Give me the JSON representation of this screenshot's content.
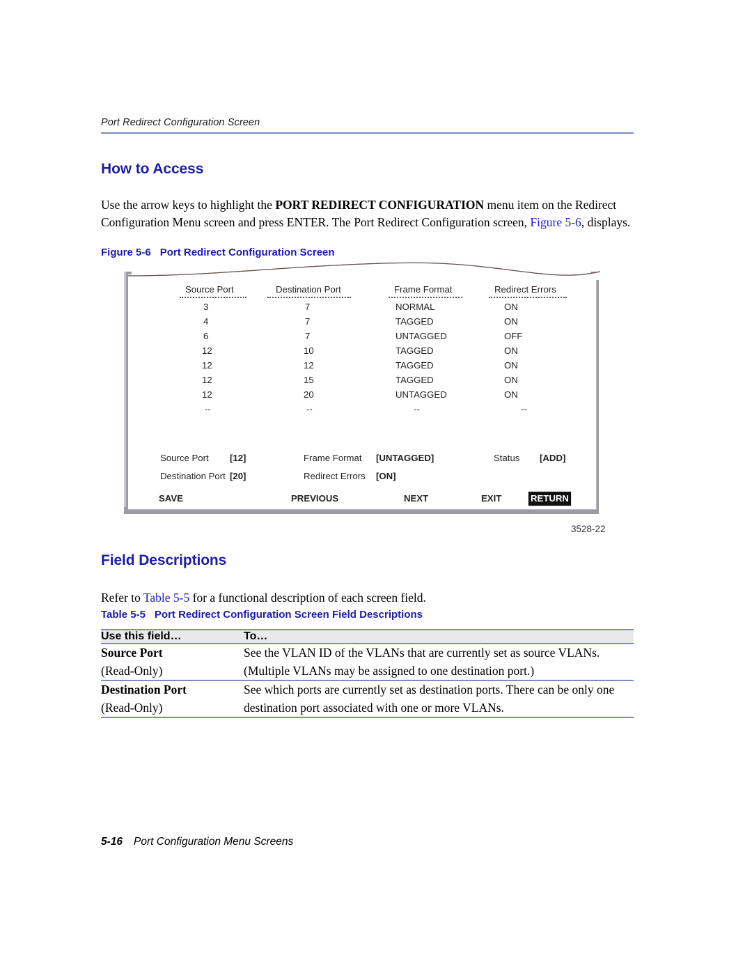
{
  "header": {
    "running_head": "Port Redirect Configuration Screen",
    "rule_color": "#8186c4"
  },
  "sections": {
    "how_to_access": {
      "heading": "How to Access",
      "para_part1": "Use the arrow keys to highlight the ",
      "para_bold": "PORT REDIRECT CONFIGURATION",
      "para_part2": " menu item on the Redirect Configuration Menu screen and press ENTER. The Port Redirect Configuration screen, ",
      "para_link": "Figure 5-6",
      "para_part3": ", displays."
    },
    "field_descriptions": {
      "heading": "Field Descriptions",
      "para_part1": "Refer to ",
      "para_link": "Table 5-5",
      "para_part2": " for a functional description of each screen field."
    }
  },
  "figure": {
    "caption_number": "Figure 5-6",
    "caption_title": "Port Redirect Configuration Screen",
    "figure_id": "3528-22",
    "screen": {
      "columns": [
        "Source Port",
        "Destination Port",
        "Frame Format",
        "Redirect Errors"
      ],
      "rows": [
        [
          "3",
          "7",
          "NORMAL",
          "ON"
        ],
        [
          "4",
          "7",
          "TAGGED",
          "ON"
        ],
        [
          "6",
          "7",
          "UNTAGGED",
          "OFF"
        ],
        [
          "12",
          "10",
          "TAGGED",
          "ON"
        ],
        [
          "12",
          "12",
          "TAGGED",
          "ON"
        ],
        [
          "12",
          "15",
          "TAGGED",
          "ON"
        ],
        [
          "12",
          "20",
          "UNTAGGED",
          "ON"
        ],
        [
          "--",
          "--",
          "--",
          "--"
        ]
      ],
      "fields": [
        {
          "label": "Source Port",
          "value": "[12]"
        },
        {
          "label": "Destination Port",
          "value": "[20]"
        },
        {
          "label": "Frame Format",
          "value": "[UNTAGGED]"
        },
        {
          "label": "Redirect Errors",
          "value": "[ON]"
        },
        {
          "label": "Status",
          "value": "[ADD]"
        }
      ],
      "commands": [
        {
          "label": "SAVE",
          "selected": false
        },
        {
          "label": "PREVIOUS",
          "selected": false
        },
        {
          "label": "NEXT",
          "selected": false
        },
        {
          "label": "EXIT",
          "selected": false
        },
        {
          "label": "RETURN",
          "selected": true
        }
      ]
    }
  },
  "table": {
    "caption_number": "Table 5-5",
    "caption_title": "Port Redirect Configuration Screen Field Descriptions",
    "headers": [
      "Use this field…",
      "To…"
    ],
    "rows": [
      {
        "field": "Source Port",
        "access": "(Read-Only)",
        "description": "See the VLAN ID of the VLANs that are currently set as source VLANs. (Multiple VLANs may be assigned to one destination port.)"
      },
      {
        "field": "Destination Port",
        "access": "(Read-Only)",
        "description": "See which ports are currently set as destination ports. There can be only one destination port associated with one or more VLANs."
      }
    ]
  },
  "footer": {
    "page_number": "5-16",
    "chapter_title": "Port Configuration Menu Screens"
  }
}
